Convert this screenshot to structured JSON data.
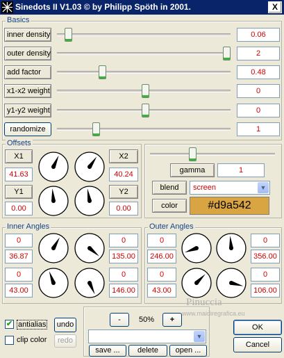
{
  "window": {
    "title": "Sinedots II V1.03 © by Philipp Spöth in 2001.",
    "close": "X"
  },
  "colors": {
    "value_text": "#d00000",
    "group_label": "#15428b",
    "color_swatch": "#d9a542",
    "slider_thumb_accent": "#3cb13c"
  },
  "basics": {
    "label": "Basics",
    "rows": [
      {
        "label": "inner density",
        "value": "0.06",
        "level": 0.03
      },
      {
        "label": "outer density",
        "value": "2",
        "level": 1.0
      },
      {
        "label": "add factor",
        "value": "0.48",
        "level": 0.24
      },
      {
        "label": "x1-x2 weight",
        "value": "0",
        "level": 0.5
      },
      {
        "label": "y1-y2 weight",
        "value": "0",
        "level": 0.5
      },
      {
        "label": "randomize",
        "value": "1",
        "level": 0.2
      }
    ]
  },
  "offsets": {
    "label": "Offsets",
    "x1_label": "X1",
    "x1_value": "41.63",
    "x2_label": "X2",
    "x2_value": "40.24",
    "y1_label": "Y1",
    "y1_value": "0.00",
    "y2_label": "Y2",
    "y2_value": "0.00"
  },
  "render": {
    "gamma_label": "gamma",
    "gamma_value": "1",
    "gamma_level": 0.3,
    "blend_label": "blend",
    "blend_value": "screen",
    "color_label": "color",
    "color_value": "#d9a542"
  },
  "inner_angles": {
    "label": "Inner Angles",
    "a1": "0",
    "a2": "36.87",
    "a3": "0",
    "a4": "135.00",
    "b1": "0",
    "b2": "43.00",
    "b3": "0",
    "b4": "146.00"
  },
  "outer_angles": {
    "label": "Outer Angles",
    "a1": "0",
    "a2": "246.00",
    "a3": "0",
    "a4": "356.00",
    "b1": "0",
    "b2": "43.00",
    "b3": "0",
    "b4": "106.00"
  },
  "bottom": {
    "antialias": "antialias",
    "antialias_checked": true,
    "clip_color": "clip color",
    "clip_checked": false,
    "undo": "undo",
    "redo": "redo",
    "minus": "-",
    "plus": "+",
    "zoom": "50%",
    "save": "save ...",
    "delete": "delete",
    "open": "open ...",
    "ok": "OK",
    "cancel": "Cancel"
  },
  "watermark": {
    "line1": "Pinuccia",
    "line2": "www.maidiregrafica.eu"
  }
}
